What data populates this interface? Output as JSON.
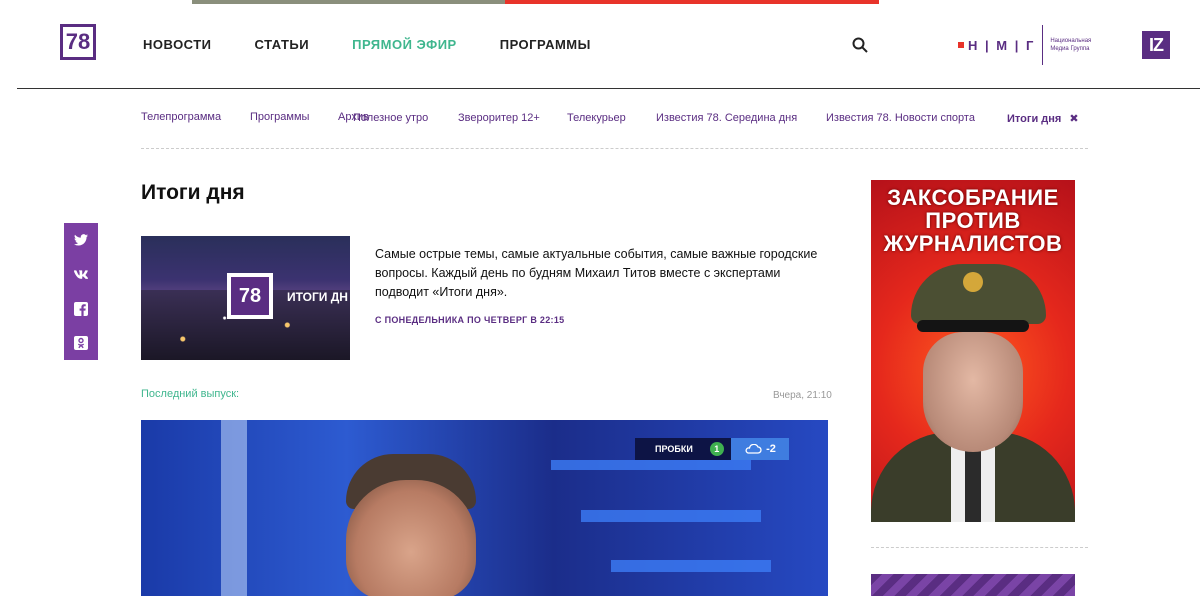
{
  "header": {
    "logo_text": "78",
    "nav": [
      {
        "label": "НОВОСТИ"
      },
      {
        "label": "СТАТЬИ"
      },
      {
        "label": "ПРЯМОЙ ЭФИР"
      },
      {
        "label": "ПРОГРАММЫ"
      }
    ],
    "partner_logo": {
      "letters": "Н | М | Г",
      "subtitle": "Национальная Медиа Группа"
    },
    "iz_logo": "IZ"
  },
  "subnav": {
    "items": [
      {
        "label": "Телепрограмма"
      },
      {
        "label": "Программы"
      },
      {
        "label": "Архив"
      },
      {
        "label": "Полезное утро"
      },
      {
        "label": "Звероритер 12+"
      },
      {
        "label": "Телекурьер"
      },
      {
        "label": "Известия 78. Середина дня"
      },
      {
        "label": "Известия 78. Новости спорта"
      },
      {
        "label": "Итоги дня"
      }
    ],
    "close_glyph": "✖"
  },
  "program": {
    "title": "Итоги дня",
    "thumb_logo": "78",
    "thumb_label": "ИТОГИ ДН",
    "description": "Самые острые темы, самые актуальные события, самые важные городские вопросы. Каждый день по будням Михаил Титов вместе с экспертами подводит «Итоги дня».",
    "schedule": "С ПОНЕДЕЛЬНИКА ПО ЧЕТВЕРГ В 22:15"
  },
  "latest": {
    "label": "Последний выпуск:",
    "time": "Вчера, 21:10",
    "overlay": {
      "traffic_label": "ПРОБКИ",
      "traffic_value": "1",
      "weather_value": "-2"
    }
  },
  "social": [
    "twitter-icon",
    "vk-icon",
    "facebook-icon",
    "odnoklassniki-icon"
  ],
  "ad": {
    "headline": "ЗАКСОБРАНИЕ ПРОТИВ ЖУРНАЛИСТОВ"
  },
  "colors": {
    "brand": "#5a2d82",
    "live": "#3fb68e",
    "accent_red": "#e8332a"
  }
}
